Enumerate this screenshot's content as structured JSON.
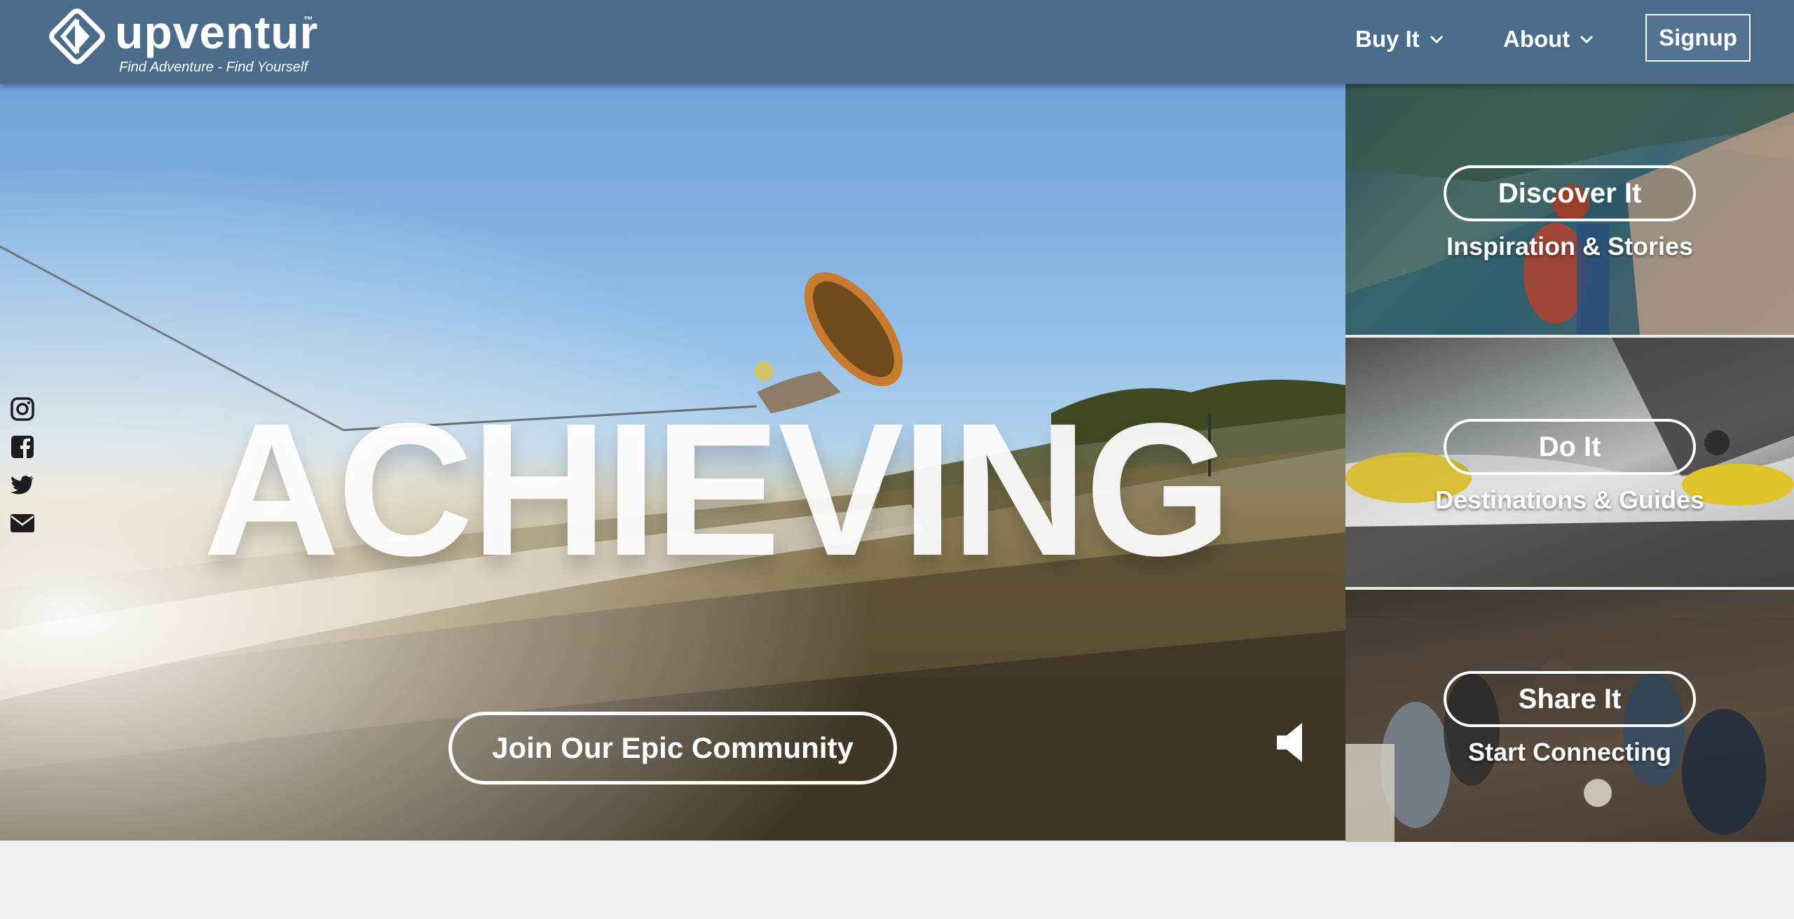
{
  "brand": {
    "name": "upventur",
    "trademark": "™",
    "tagline": "Find Adventure - Find Yourself"
  },
  "nav": {
    "buy_label": "Buy It",
    "about_label": "About",
    "signup_label": "Signup"
  },
  "hero": {
    "headline": "ACHIEVING",
    "cta_label": "Join Our Epic Community"
  },
  "social": [
    "instagram-icon",
    "facebook-icon",
    "twitter-icon",
    "email-icon"
  ],
  "panels": [
    {
      "button": "Discover It",
      "subtitle": "Inspiration & Stories"
    },
    {
      "button": "Do It",
      "subtitle": "Destinations & Guides"
    },
    {
      "button": "Share It",
      "subtitle": "Start Connecting"
    }
  ],
  "colors": {
    "header_bg": "#4a6b8a",
    "page_bg": "#eff0f2",
    "text": "#ffffff"
  }
}
